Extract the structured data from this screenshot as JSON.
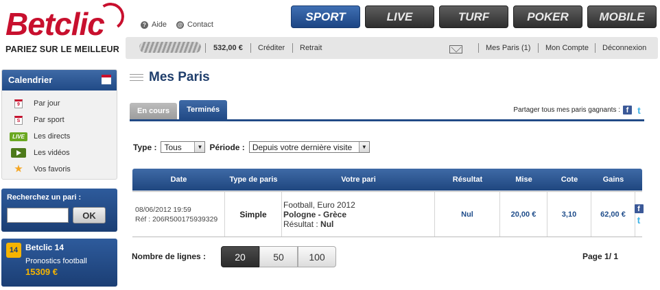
{
  "brand": {
    "name": "Betclic",
    "tagline": "PARIEZ SUR LE MEILLEUR"
  },
  "toplinks": {
    "aide": "Aide",
    "contact": "Contact"
  },
  "nav": [
    "SPORT",
    "LIVE",
    "TURF",
    "POKER",
    "MOBILE"
  ],
  "userbar": {
    "balance": "532,00 €",
    "crediter": "Créditer",
    "retrait": "Retrait",
    "mes_paris": "Mes Paris (1)",
    "mon_compte": "Mon Compte",
    "deconnexion": "Déconnexion"
  },
  "sidebar": {
    "calendar_title": "Calendrier",
    "calendar_items": [
      {
        "label": "Par jour",
        "icon": "calendar-day-icon",
        "icon_text": "9"
      },
      {
        "label": "Par sport",
        "icon": "calendar-sport-icon",
        "icon_text": "S"
      },
      {
        "label": "Les directs",
        "icon": "live-icon",
        "icon_text": "LIVE"
      },
      {
        "label": "Les vidéos",
        "icon": "video-icon"
      },
      {
        "label": "Vos favoris",
        "icon": "star-icon"
      }
    ],
    "search_label": "Recherchez un pari :",
    "search_value": "",
    "ok_label": "OK",
    "promo": {
      "badge": "14",
      "title": "Betclic 14",
      "subtitle": "Pronostics football",
      "amount": "15309 €"
    }
  },
  "main": {
    "title": "Mes Paris",
    "tabs": [
      "En cours",
      "Terminés"
    ],
    "active_tab": "Terminés",
    "share_text": "Partager tous mes paris gagnants :",
    "filters": {
      "type_label": "Type :",
      "type_value": "Tous",
      "periode_label": "Période :",
      "periode_value": "Depuis votre dernière visite"
    },
    "table": {
      "headers": [
        "Date",
        "Type de paris",
        "Votre pari",
        "Résultat",
        "Mise",
        "Cote",
        "Gains"
      ],
      "rows": [
        {
          "date": "08/06/2012 19:59",
          "ref": "Réf : 206R500175939329",
          "type": "Simple",
          "competition": "Football, Euro 2012",
          "match": "Pologne - Grèce",
          "result_label": "Résultat  :",
          "result_value": "Nul",
          "resultat": "Nul",
          "mise": "20,00 €",
          "cote": "3,10",
          "gains": "62,00 €"
        }
      ]
    },
    "lines_label": "Nombre de lignes :",
    "page_sizes": [
      "20",
      "50",
      "100"
    ],
    "page_info": "Page 1/ 1"
  },
  "colors": {
    "brand_red": "#c8102e",
    "nav_active": "#214a86",
    "accent_yellow": "#f5b400"
  }
}
